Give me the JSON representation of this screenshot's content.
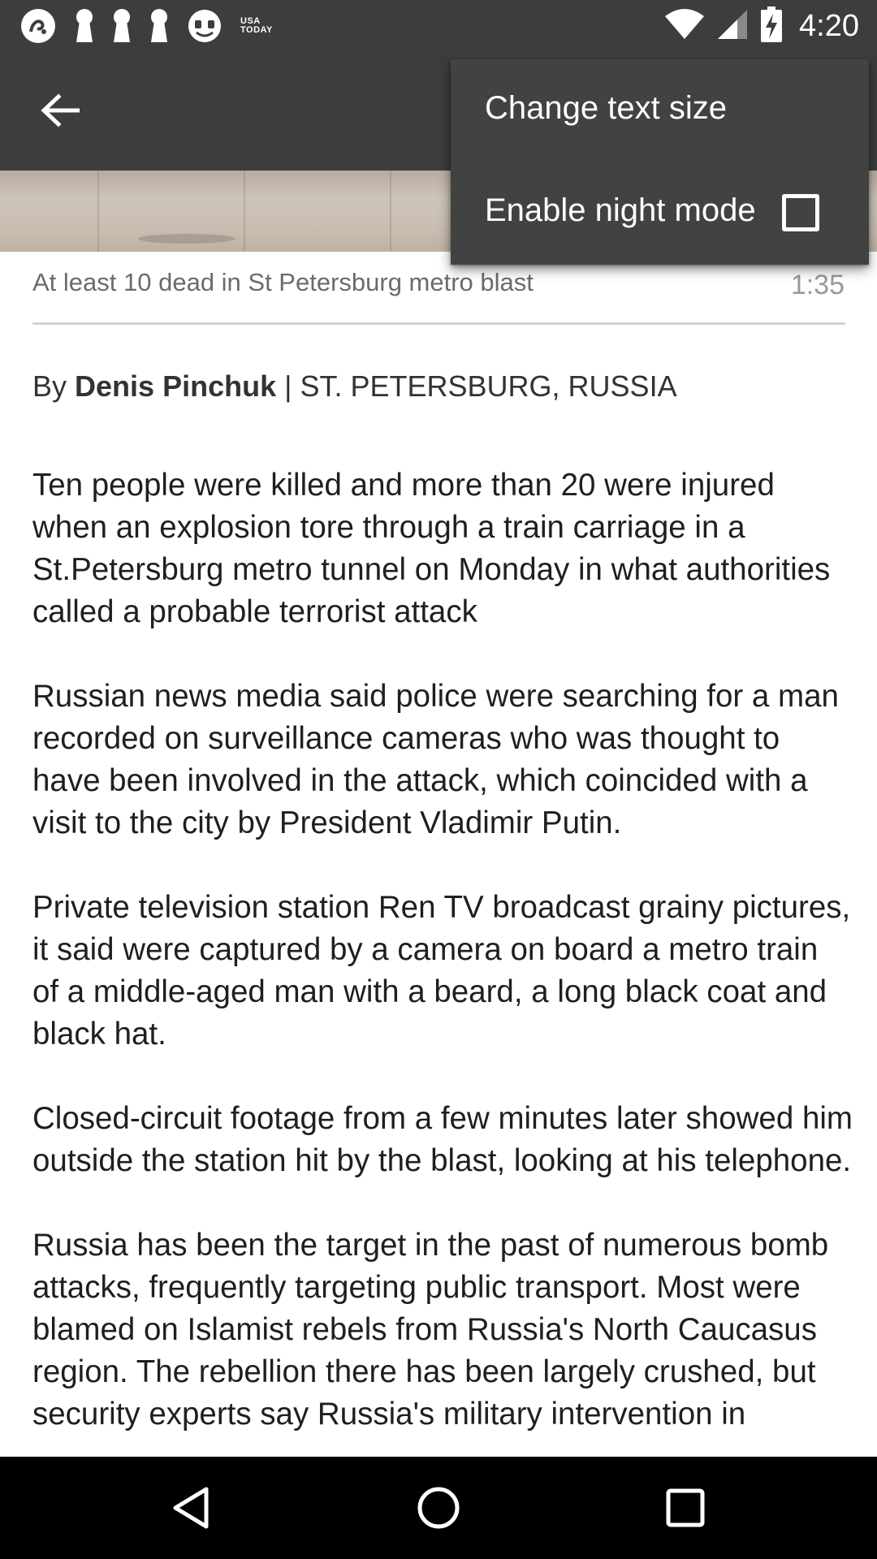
{
  "status_bar": {
    "time": "4:20",
    "usa_today_line1": "USA",
    "usa_today_line2": "TODAY",
    "icons": [
      "reuters-icon",
      "keyhole-icon",
      "keyhole-icon",
      "keyhole-icon",
      "face-icon",
      "usa-today-icon",
      "wifi-icon",
      "signal-icon",
      "battery-charging-icon"
    ]
  },
  "toolbar": {
    "back_icon": "arrow-back-icon"
  },
  "overflow_menu": {
    "items": [
      {
        "label": "Change text size"
      },
      {
        "label": "Enable night mode",
        "checked": false
      }
    ]
  },
  "video": {
    "title": "At least 10 dead in St Petersburg metro blast",
    "duration": "1:35"
  },
  "byline": {
    "prefix": "By",
    "author": "Denis Pinchuk",
    "separator": "|",
    "location": "ST. PETERSBURG, RUSSIA"
  },
  "article": {
    "paragraphs": [
      "Ten people were killed and more than 20 were injured when an explosion tore through a train carriage in a St.Petersburg metro tunnel on Monday in what authorities called a probable terrorist attack",
      "Russian news media said police were searching for a man recorded on surveillance cameras who was thought to have been involved in the attack, which coincided with a visit to the city by President Vladimir Putin.",
      "Private television station Ren TV broadcast grainy pictures, it said were captured by a camera on board a metro train of a middle-aged man with a beard, a long black coat and black hat.",
      "Closed-circuit footage from a few minutes later showed him outside the station hit by the blast, looking at his telephone.",
      "Russia has been the target in the past of numerous bomb attacks, frequently targeting public transport. Most were blamed on Islamist rebels from Russia's North Caucasus region. The rebellion there has been largely crushed, but security experts say Russia's military intervention in"
    ]
  },
  "nav_bar": {
    "icons": [
      "back-triangle-icon",
      "home-circle-icon",
      "recents-square-icon"
    ]
  },
  "colors": {
    "app_bar": "#3d3d3d",
    "menu_bg": "#424242",
    "nav_bar": "#000000"
  }
}
